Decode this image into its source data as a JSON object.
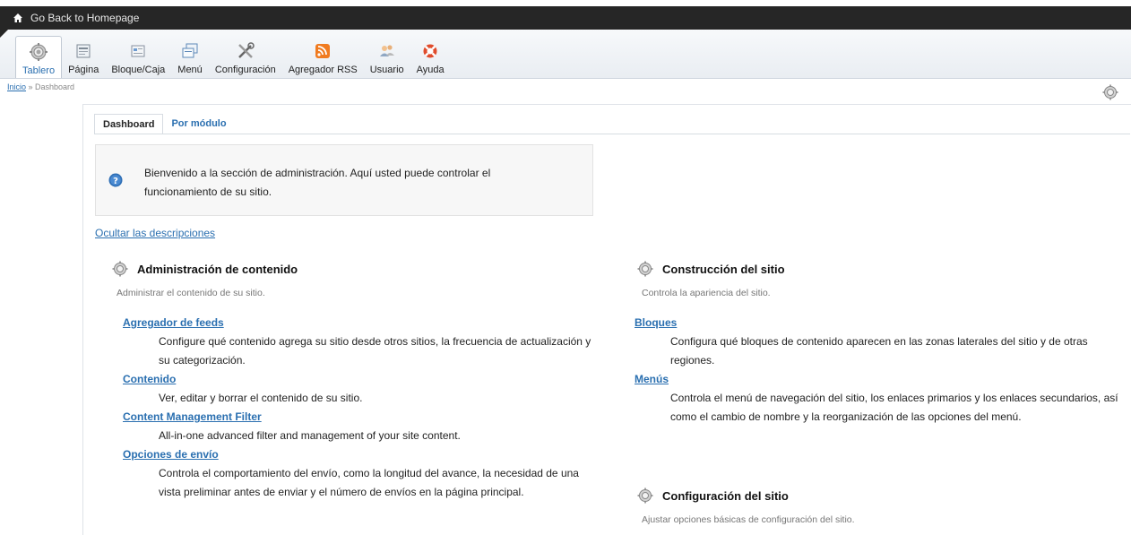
{
  "topbar": {
    "home_icon": "home-icon",
    "link": "Go Back to Homepage"
  },
  "toolbar": {
    "items": [
      {
        "label": "Tablero",
        "icon": "dashboard-gear-icon"
      },
      {
        "label": "Página",
        "icon": "page-icon"
      },
      {
        "label": "Bloque/Caja",
        "icon": "block-icon"
      },
      {
        "label": "Menú",
        "icon": "menu-icon"
      },
      {
        "label": "Configuración",
        "icon": "tools-icon"
      },
      {
        "label": "Agregador RSS",
        "icon": "rss-icon"
      },
      {
        "label": "Usuario",
        "icon": "users-icon"
      },
      {
        "label": "Ayuda",
        "icon": "help-lifebuoy-icon"
      }
    ]
  },
  "breadcrumb": {
    "home": "Inicio",
    "separator": " » ",
    "current": "Dashboard"
  },
  "tabs": {
    "dashboard": "Dashboard",
    "by_module": "Por módulo"
  },
  "welcome": {
    "text": "Bienvenido a la sección de administración. Aquí usted puede controlar el funcionamiento de su sitio."
  },
  "hide_descriptions": "Ocultar las descripciones",
  "sections": {
    "content_admin": {
      "title": "Administración de contenido",
      "desc": "Administrar el contenido de su sitio.",
      "items": [
        {
          "title": "Agregador de feeds",
          "desc": "Configure qué contenido agrega su sitio desde otros sitios, la frecuencia de actualización y su categorización."
        },
        {
          "title": "Contenido",
          "desc": "Ver, editar y borrar el contenido de su sitio."
        },
        {
          "title": "Content Management Filter",
          "desc": "All-in-one advanced filter and management of your site content."
        },
        {
          "title": "Opciones de envío",
          "desc": "Controla el comportamiento del envío, como la longitud del avance, la necesidad de una vista preliminar antes de enviar y el número de envíos en la página principal."
        }
      ]
    },
    "site_building": {
      "title": "Construcción del sitio",
      "desc": "Controla la apariencia del sitio.",
      "items": [
        {
          "title": "Bloques",
          "desc": "Configura qué bloques de contenido aparecen en las zonas laterales del sitio y de otras regiones."
        },
        {
          "title": "Menús",
          "desc": "Controla el menú de navegación del sitio, los enlaces primarios y los enlaces secundarios, así como el cambio de nombre y la reorganización de las opciones del menú."
        }
      ]
    },
    "site_config": {
      "title": "Configuración del sitio",
      "desc": "Ajustar opciones básicas de configuración del sitio."
    }
  },
  "colors": {
    "link": "#2a6fb0",
    "topbar": "#262626",
    "rss": "#f07b20",
    "help": "#e04c2c"
  }
}
